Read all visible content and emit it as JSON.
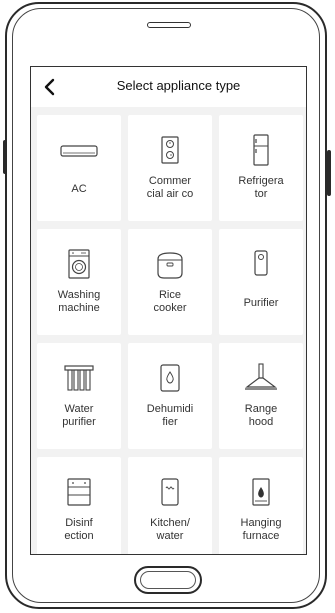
{
  "header": {
    "title": "Select appliance type"
  },
  "appliances": [
    {
      "line1": "AC",
      "line2": "",
      "icon": "ac-icon"
    },
    {
      "line1": "Commer",
      "line2": "cial air co",
      "icon": "commercial-air-conditioner-icon"
    },
    {
      "line1": "Refrigera",
      "line2": "tor",
      "icon": "refrigerator-icon"
    },
    {
      "line1": "Washing",
      "line2": "machine",
      "icon": "washing-machine-icon"
    },
    {
      "line1": "Rice",
      "line2": "cooker",
      "icon": "rice-cooker-icon"
    },
    {
      "line1": "Purifier",
      "line2": "",
      "icon": "purifier-icon"
    },
    {
      "line1": "Water",
      "line2": "purifier",
      "icon": "water-purifier-icon"
    },
    {
      "line1": "Dehumidi",
      "line2": "fier",
      "icon": "dehumidifier-icon"
    },
    {
      "line1": "Range",
      "line2": "hood",
      "icon": "range-hood-icon"
    },
    {
      "line1": "Disinf",
      "line2": "ection",
      "icon": "disinfection-cabinet-icon"
    },
    {
      "line1": "Kitchen/",
      "line2": "water",
      "icon": "kitchen-water-heater-icon"
    },
    {
      "line1": "Hanging",
      "line2": "furnace",
      "icon": "hanging-furnace-icon"
    }
  ],
  "colors": {
    "background": "#f2f2f2",
    "tile": "#ffffff",
    "text": "#333333"
  }
}
